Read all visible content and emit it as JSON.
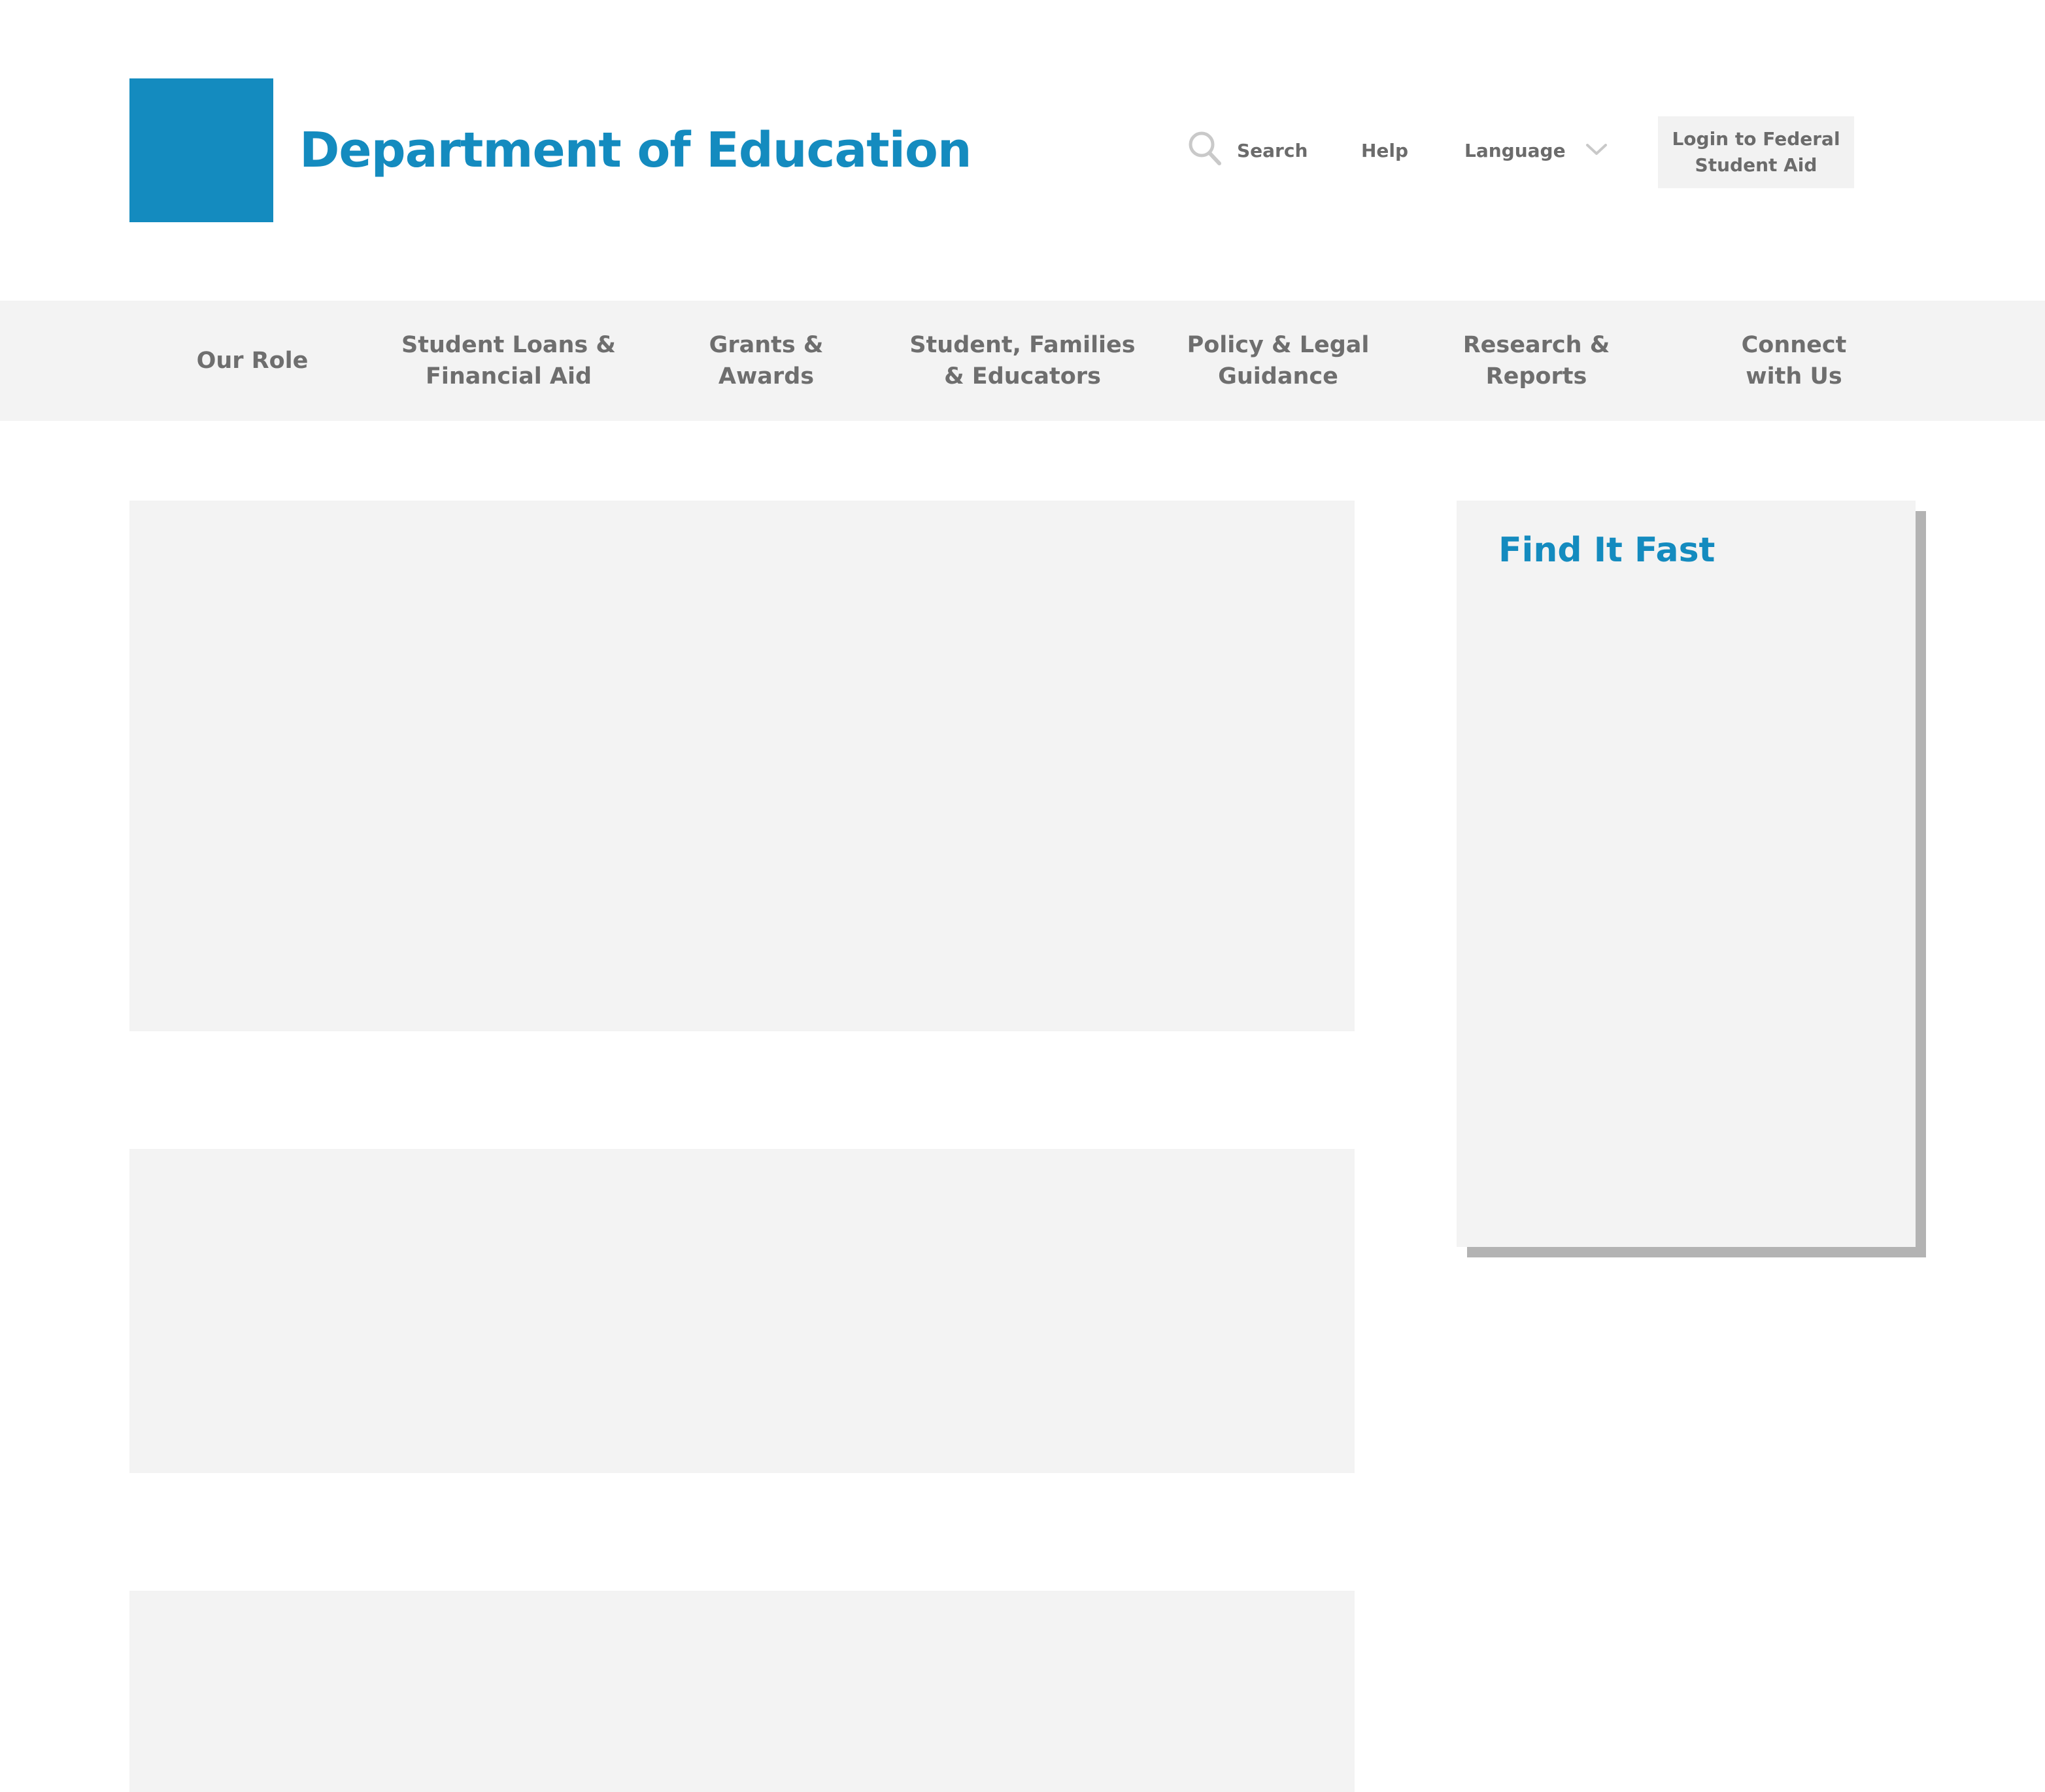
{
  "header": {
    "site_title": "Department of Education",
    "utility": {
      "search_label": "Search",
      "help_label": "Help",
      "language_label": "Language",
      "login_label": "Login to Federal\nStudent Aid"
    }
  },
  "nav": {
    "items": [
      {
        "label": "Our Role"
      },
      {
        "label": "Student Loans &\nFinancial Aid"
      },
      {
        "label": "Grants &\nAwards"
      },
      {
        "label": "Student, Families\n& Educators"
      },
      {
        "label": "Policy & Legal\nGuidance"
      },
      {
        "label": "Research &\nReports"
      },
      {
        "label": "Connect\nwith Us"
      }
    ]
  },
  "sidebar": {
    "title": "Find It Fast"
  },
  "colors": {
    "brand": "#148BBF",
    "text_gray": "#6b6b6b",
    "panel_gray": "#f3f3f3",
    "shadow_gray": "#b3b3b3"
  },
  "icons": {
    "search": "search-icon",
    "language_dropdown": "chevron-down-icon"
  }
}
